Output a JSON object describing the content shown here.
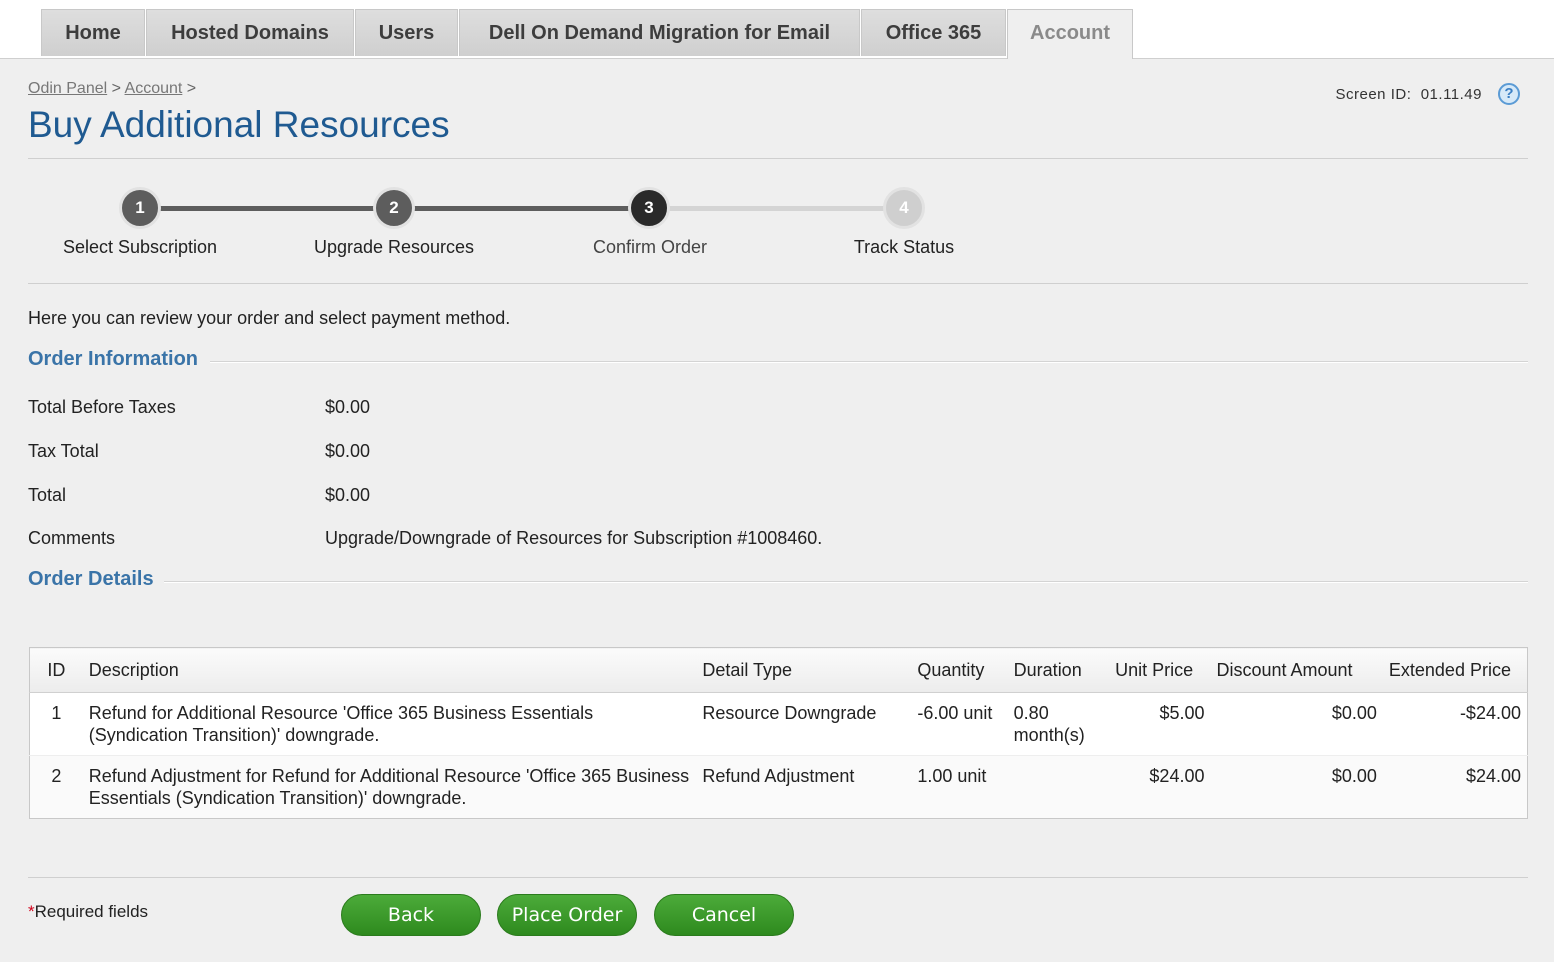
{
  "tabs": [
    {
      "label": "Home"
    },
    {
      "label": "Hosted Domains"
    },
    {
      "label": "Users"
    },
    {
      "label": "Dell On Demand Migration for Email"
    },
    {
      "label": "Office 365"
    },
    {
      "label": "Account"
    }
  ],
  "breadcrumb": {
    "root": "Odin Panel",
    "sep": ">",
    "account": "Account"
  },
  "page_title": "Buy Additional Resources",
  "screen_id": {
    "label": "Screen ID:",
    "value": "01.11.49"
  },
  "help_icon": "?",
  "wizard": {
    "steps": [
      {
        "num": "1",
        "label": "Select Subscription"
      },
      {
        "num": "2",
        "label": "Upgrade Resources"
      },
      {
        "num": "3",
        "label": "Confirm Order"
      },
      {
        "num": "4",
        "label": "Track Status"
      }
    ],
    "current_step": 3
  },
  "intro": "Here you can review your order and select payment method.",
  "order_information": {
    "title": "Order Information",
    "rows": [
      {
        "label": "Total Before Taxes",
        "value": "$0.00"
      },
      {
        "label": "Tax Total",
        "value": "$0.00"
      },
      {
        "label": "Total",
        "value": "$0.00"
      },
      {
        "label": "Comments",
        "value": "Upgrade/Downgrade of Resources for Subscription #1008460."
      }
    ]
  },
  "order_details": {
    "title": "Order Details",
    "columns": [
      "ID",
      "Description",
      "Detail Type",
      "Quantity",
      "Duration",
      "Unit Price",
      "Discount Amount",
      "Extended Price"
    ],
    "rows": [
      {
        "id": "1",
        "description": "Refund for Additional Resource 'Office 365 Business Essentials (Syndication Transition)' downgrade.",
        "detail_type": "Resource Downgrade",
        "quantity": "-6.00 unit",
        "duration": "0.80 month(s)",
        "unit_price": "$5.00",
        "discount": "$0.00",
        "extended": "-$24.00"
      },
      {
        "id": "2",
        "description": "Refund Adjustment for Refund for Additional Resource 'Office 365 Business Essentials (Syndication Transition)' downgrade.",
        "detail_type": "Refund Adjustment",
        "quantity": "1.00 unit",
        "duration": "",
        "unit_price": "$24.00",
        "discount": "$0.00",
        "extended": "$24.00"
      }
    ]
  },
  "required_note": {
    "star": "*",
    "text": "Required fields"
  },
  "buttons": {
    "back": "Back",
    "place_order": "Place Order",
    "cancel": "Cancel"
  },
  "colors": {
    "accent": "#1f5a91",
    "button_green": "#3a9a2a",
    "negative": "#e0102a",
    "step_done": "#5d5d5d",
    "step_current": "#2a2a2a",
    "step_pending": "#cfcfcf"
  }
}
